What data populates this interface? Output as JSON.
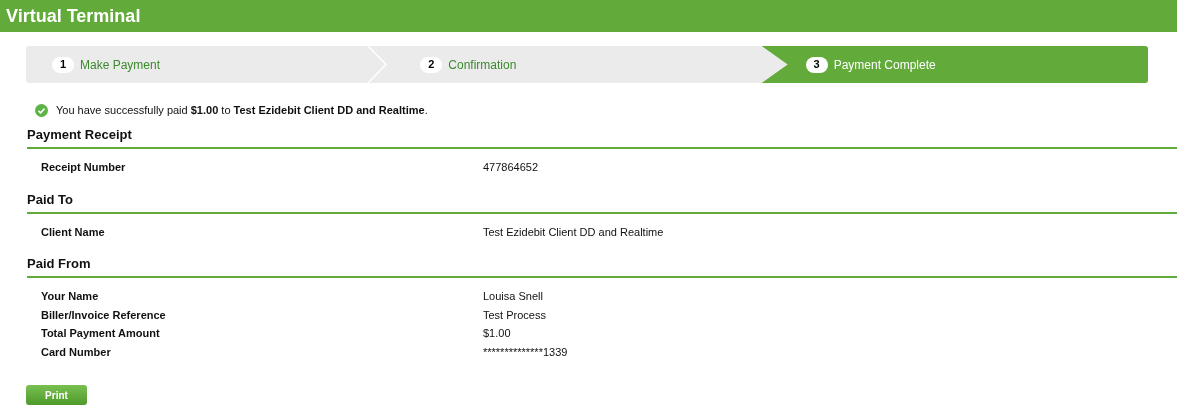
{
  "header": {
    "title": "Virtual Terminal"
  },
  "steps": [
    {
      "number": "1",
      "label": "Make Payment",
      "selected": false
    },
    {
      "number": "2",
      "label": "Confirmation",
      "selected": false
    },
    {
      "number": "3",
      "label": "Payment Complete",
      "selected": true
    }
  ],
  "message": "You have successfully paid **$1.00** to **Test Ezidebit Client DD and Realtime**.",
  "sections": [
    {
      "title": "Payment Receipt",
      "rows": [
        {
          "label": "Receipt Number",
          "value": "477864652"
        }
      ]
    },
    {
      "title": "Paid To",
      "rows": [
        {
          "label": "Client Name",
          "value": "Test Ezidebit Client DD and Realtime"
        }
      ]
    },
    {
      "title": "Paid From",
      "rows": [
        {
          "label": "Your Name",
          "value": "Louisa Snell"
        },
        {
          "label": "Biller/Invoice Reference",
          "value": "Test Process"
        },
        {
          "label": "Total Payment Amount",
          "value": "$1.00"
        },
        {
          "label": "Card Number",
          "value": "**************1339"
        }
      ]
    }
  ],
  "print_button": "Print"
}
